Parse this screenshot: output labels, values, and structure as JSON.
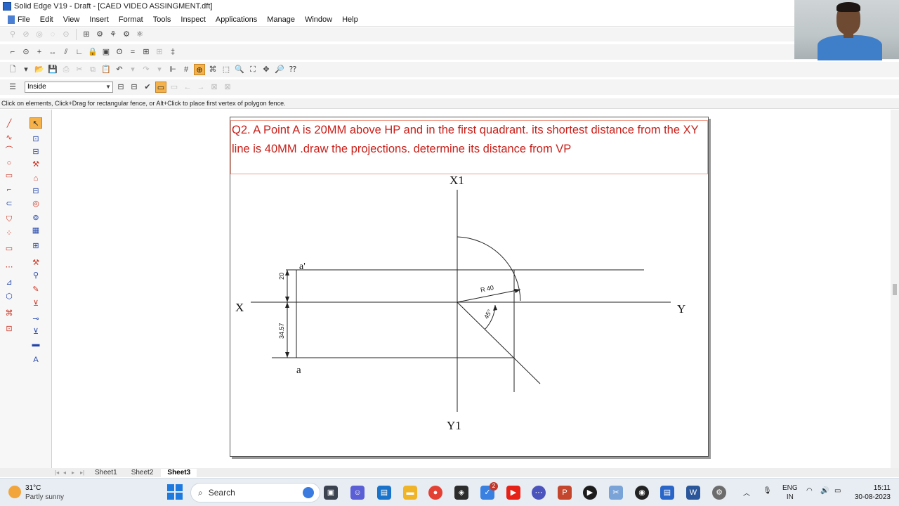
{
  "window": {
    "title": "Solid Edge V19 - Draft - [CAED VIDEO ASSINGMENT.dft]"
  },
  "menubar": {
    "items": [
      "File",
      "Edit",
      "View",
      "Insert",
      "Format",
      "Tools",
      "Inspect",
      "Applications",
      "Manage",
      "Window",
      "Help"
    ]
  },
  "selection_toolbar": {
    "filter_value": "Inside"
  },
  "prompt_bar": {
    "text": "Click on elements, Click+Drag for rectangular fence, or Alt+Click to place first vertex of polygon fence."
  },
  "drawing": {
    "question": "Q2. A Point A is 20MM above HP and in the first quadrant. its shortest distance from the XY line is 40MM .draw the projections. determine its distance from VP",
    "labels": {
      "x": "X",
      "y": "Y",
      "x1": "X1",
      "y1": "Y1",
      "a_prime": "a'",
      "a": "a",
      "dim_20": "20",
      "dim_3457": "34.57",
      "radius": "R 40",
      "angle": "45°"
    }
  },
  "sheet_tabs": {
    "items": [
      "Sheet1",
      "Sheet2",
      "Sheet3"
    ],
    "active": "Sheet3"
  },
  "taskbar": {
    "weather_temp": "31°C",
    "weather_condition": "Partly sunny",
    "search_placeholder": "Search",
    "language_top": "ENG",
    "language_bottom": "IN",
    "time": "15:11",
    "date": "30-08-2023",
    "badge_count": "2"
  },
  "colors": {
    "question_text": "#c8201a",
    "active_tool": "#f6b24a",
    "taskbar_bg": "#e8edf3"
  }
}
